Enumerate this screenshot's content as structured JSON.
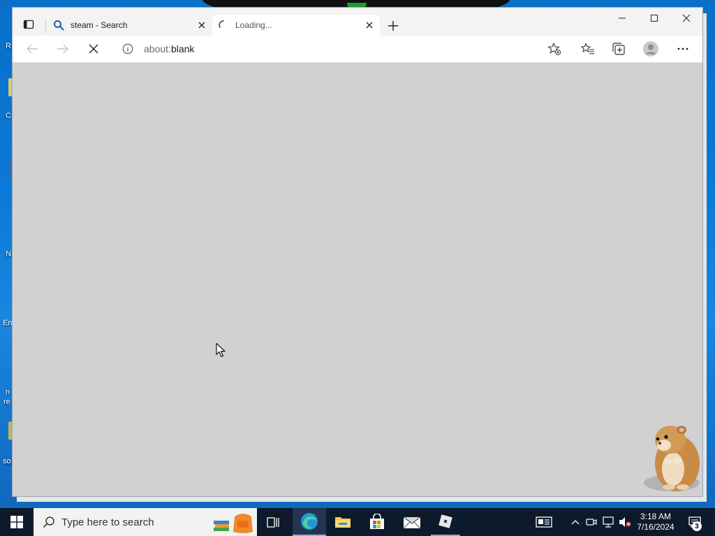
{
  "desktop": {
    "slivers": [
      "R",
      "C",
      "N",
      "En",
      "n",
      "re",
      "so"
    ]
  },
  "browser": {
    "tabs": [
      {
        "title": "steam - Search",
        "icon": "search-icon",
        "active": false
      },
      {
        "title": "Loading...",
        "icon": "loading-spinner-icon",
        "active": true
      }
    ],
    "new_tab_icon": "plus-icon",
    "window_controls": [
      "minimize-icon",
      "maximize-icon",
      "close-icon"
    ],
    "address": {
      "url_prefix": "about:",
      "url_main": "blank"
    },
    "toolbar_icons": [
      "back-arrow-icon",
      "forward-arrow-icon",
      "stop-loading-icon",
      "info-icon",
      "add-favorite-icon",
      "favorites-icon",
      "collections-icon",
      "profile-icon",
      "more-options-icon"
    ],
    "colors": {
      "content_bg": "#d1d1d1",
      "tabstrip_bg": "#f3f3f3",
      "accent": "#0067c0"
    }
  },
  "taskbar": {
    "search_placeholder": "Type here to search",
    "apps": [
      "task-view-icon",
      "edge-icon",
      "file-explorer-icon",
      "microsoft-store-icon",
      "mail-icon",
      "roblox-icon"
    ],
    "tray": {
      "time": "3:18 AM",
      "date": "7/16/2024",
      "notifications_count": "3"
    }
  }
}
